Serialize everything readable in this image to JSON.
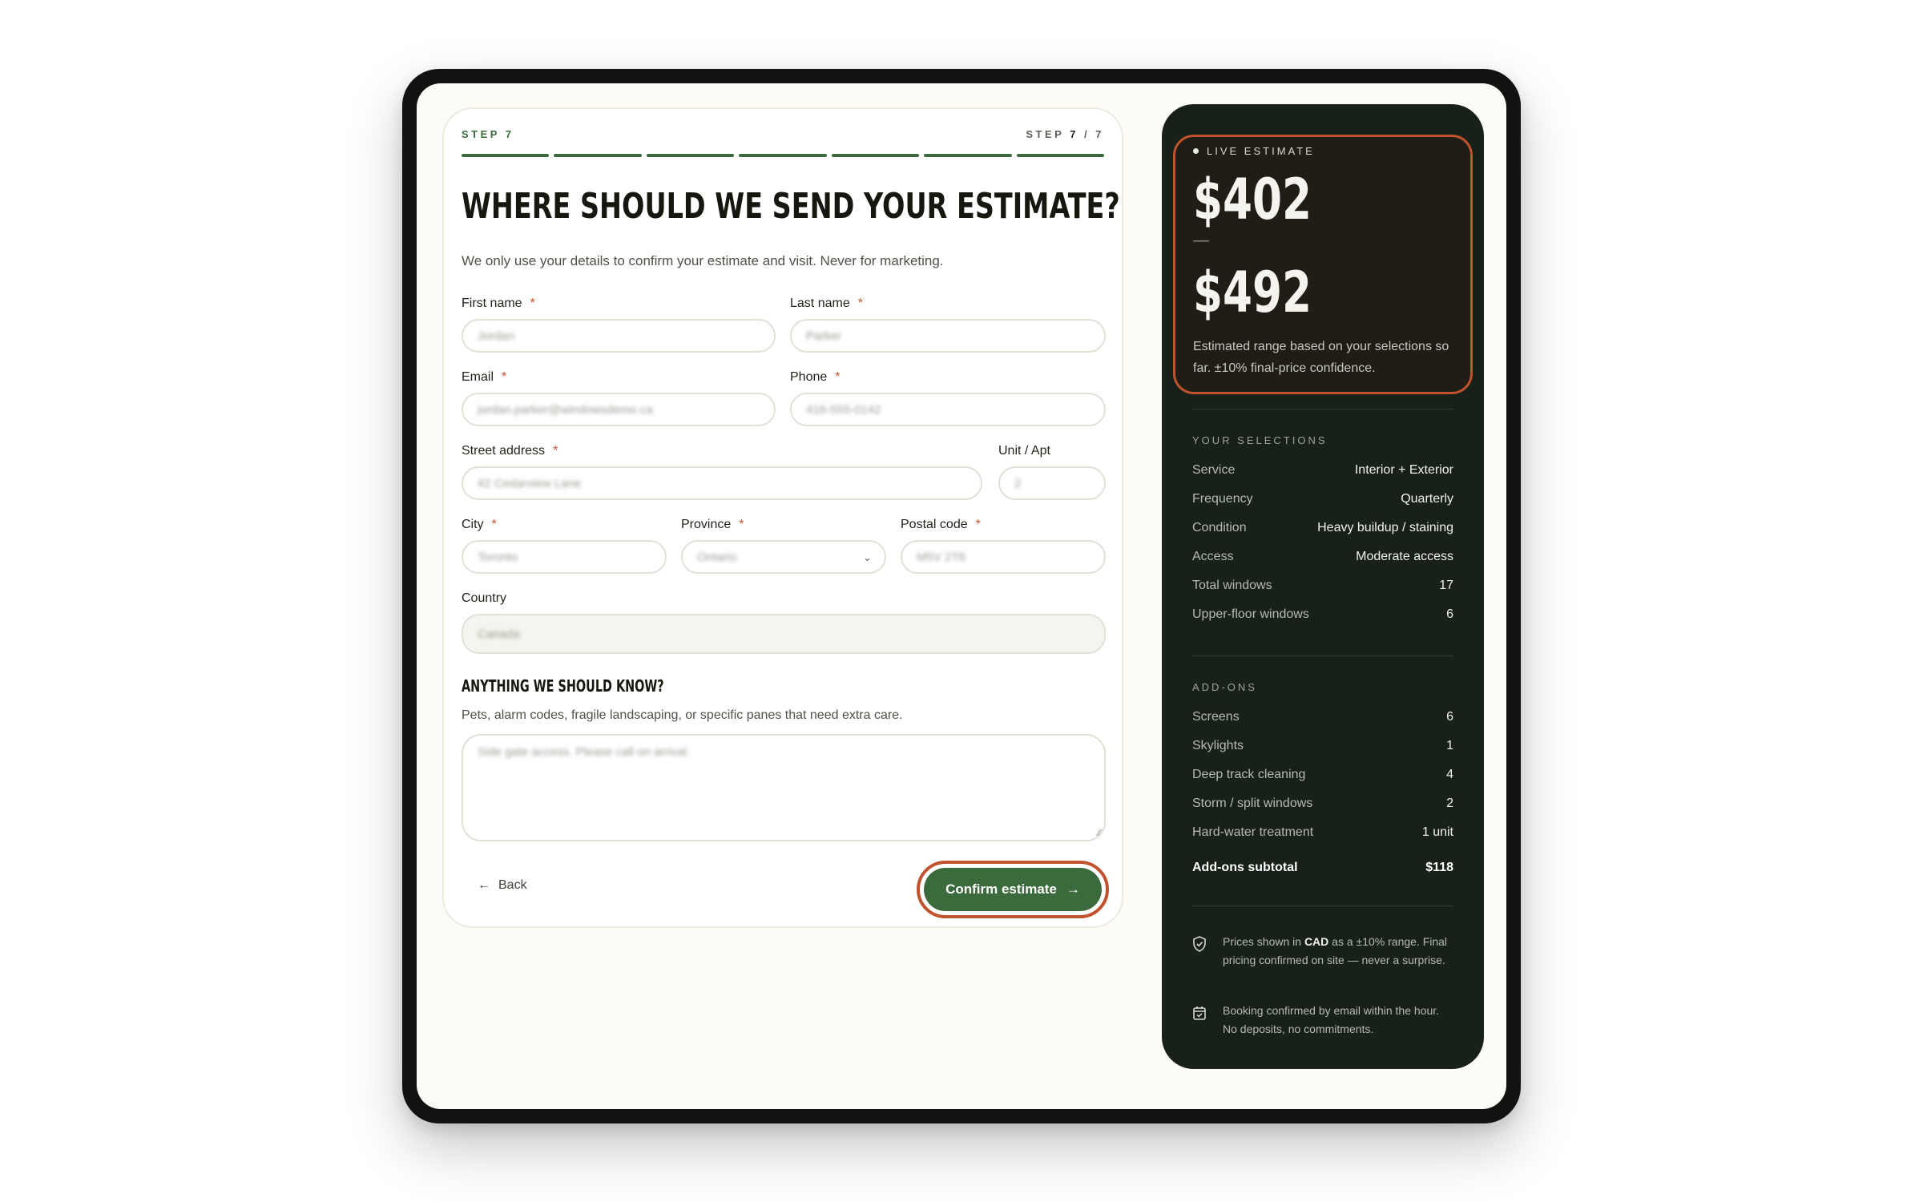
{
  "stepper": {
    "left_label": "STEP 7",
    "right_prefix": "STEP ",
    "current": "7",
    "right_suffix": " / 7",
    "total_segments": 7
  },
  "form": {
    "title": "Where should we send your estimate?",
    "subtitle": "We only use your details to confirm your estimate and visit. Never for marketing.",
    "required_mark": "*",
    "fields": {
      "first_name": {
        "label": "First name",
        "value": "Jordan"
      },
      "last_name": {
        "label": "Last name",
        "value": "Parker"
      },
      "email": {
        "label": "Email",
        "value": "jordan.parker@windowsdemo.ca"
      },
      "phone": {
        "label": "Phone",
        "value": "416-555-0142"
      },
      "street": {
        "label": "Street address",
        "value": "42 Cedarview Lane"
      },
      "unit": {
        "label": "Unit / Apt",
        "value": "2"
      },
      "city": {
        "label": "City",
        "value": "Toronto"
      },
      "province": {
        "label": "Province",
        "value": "Ontario"
      },
      "postal": {
        "label": "Postal code",
        "value": "M5V 2T6"
      },
      "country": {
        "label": "Country",
        "value": "Canada"
      }
    },
    "notes": {
      "heading": "Anything we should know?",
      "hint": "Pets, alarm codes, fragile landscaping, or specific panes that need extra care.",
      "value": "Side gate access. Please call on arrival."
    },
    "back_label": "Back",
    "confirm_label": "Confirm estimate"
  },
  "estimate": {
    "tag": "LIVE ESTIMATE",
    "low": "$402",
    "dash": "—",
    "high": "$492",
    "note": "Estimated range based on your selections so far. ±10% final-price confidence.",
    "selections_title": "YOUR SELECTIONS",
    "selections": [
      {
        "label": "Service",
        "value": "Interior + Exterior"
      },
      {
        "label": "Frequency",
        "value": "Quarterly"
      },
      {
        "label": "Condition",
        "value": "Heavy buildup / staining"
      },
      {
        "label": "Access",
        "value": "Moderate access"
      },
      {
        "label": "Total windows",
        "value": "17"
      },
      {
        "label": "Upper-floor windows",
        "value": "6"
      }
    ],
    "addons_title": "ADD-ONS",
    "addons": [
      {
        "label": "Screens",
        "value": "6"
      },
      {
        "label": "Skylights",
        "value": "1"
      },
      {
        "label": "Deep track cleaning",
        "value": "4"
      },
      {
        "label": "Storm / split windows",
        "value": "2"
      },
      {
        "label": "Hard-water treatment",
        "value": "1 unit"
      }
    ],
    "addons_subtotal_label": "Add-ons subtotal",
    "addons_subtotal_value": "$118",
    "footnote_1_pre": "Prices shown in ",
    "footnote_1_bold": "CAD",
    "footnote_1_post": " as a ±10% range. Final pricing confirmed on site — never a surprise.",
    "footnote_2": "Booking confirmed by email within the hour. No deposits, no commitments."
  }
}
